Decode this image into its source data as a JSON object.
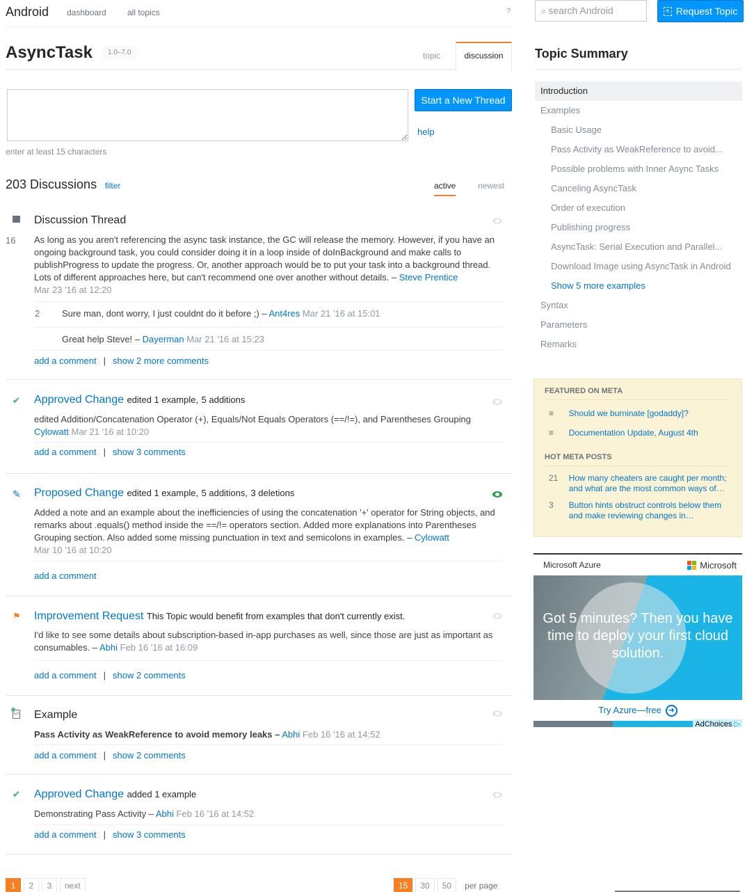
{
  "header": {
    "brand": "Android",
    "nav": [
      "dashboard",
      "all topics"
    ],
    "help_icon": "?",
    "search_placeholder": "search Android",
    "request_topic_label": "Request Topic"
  },
  "topic": {
    "title": "AsyncTask",
    "version": "1.0–7.0",
    "tabs": [
      {
        "label": "topic",
        "active": false
      },
      {
        "label": "discussion",
        "active": true
      }
    ]
  },
  "new_thread": {
    "input_value": "",
    "start_label": "Start a New Thread",
    "help_label": "help",
    "hint": "enter at least 15 characters"
  },
  "discussions": {
    "count_label": "203 Discussions",
    "filter_label": "filter",
    "sort": [
      {
        "label": "active",
        "active": true
      },
      {
        "label": "newest",
        "active": false
      }
    ]
  },
  "posts": [
    {
      "type": "Discussion Thread",
      "icon": "comment-bubble-icon",
      "votes": "16",
      "body": "As long as you aren't referencing the async task instance, the GC will release the memory. However, if you have an ongoing background task, you could consider doing it in a loop inside of doInBackground and make calls to publishProgress to update the progress. Or, another approach would be to put your task into a background thread. Lots of different approaches here, but can't recommend one over another without details. –",
      "author": "Steve Prentice",
      "time": "Mar 23 '16 at 12:20",
      "comments": [
        {
          "votes": "2",
          "text": "Sure man, dont worry, I just couldnt do it before ;) –",
          "author": "Ant4res",
          "time": "Mar 21 '16 at 15:01"
        },
        {
          "votes": "",
          "text": "Great help Steve! –",
          "author": "Dayerman",
          "time": "Mar 21 '16 at 15:23"
        }
      ],
      "add_comment": "add a comment",
      "show_comments": "show 2 more comments"
    },
    {
      "type": "Approved Change",
      "icon": "checkmark-icon",
      "meta": "edited 1 example,",
      "additions": "5 additions",
      "body": "edited Addition/Concatenation Operator (+), Equals/Not Equals Operators (==/!=), and Parentheses Grouping",
      "author": "Cylowatt",
      "time": "Mar 21 '16 at 10:20",
      "add_comment": "add a comment",
      "show_comments": "show 3 comments"
    },
    {
      "type": "Proposed Change",
      "icon": "pencil-icon",
      "meta": "edited 1 example,",
      "additions": "5 additions,",
      "deletions": "3 deletions",
      "body": "Added a note and an example about the inefficiencies of using the concatenation '+' operator for String objects, and remarks about .equals() method inside the ==/!= operators section. Added more explanations into Parentheses Grouping section. Also added some missing punctuation in text and semicolons in examples. –",
      "author": "Cylowatt",
      "time": "Mar 10 '16 at 10:20",
      "add_comment": "add a comment"
    },
    {
      "type": "Improvement Request",
      "icon": "flag-icon",
      "meta": "This Topic would benefit from examples that don't currently exist.",
      "body": "I'd like to see some details about subscription-based in-app purchases as well, since those are just as important as consumables. –",
      "author": "Abhi",
      "time": "Feb 16 '16 at 16:09",
      "add_comment": "add a comment",
      "show_comments": "show 2 comments"
    },
    {
      "type": "Example",
      "icon": "add-example-icon",
      "body": "Pass Activity as WeakReference to avoid memory leaks –",
      "author": "Abhi",
      "time": "Feb 16 '16 at 14:52",
      "add_comment": "add a comment",
      "show_comments": "show 2 comments"
    },
    {
      "type": "Approved Change",
      "icon": "checkmark-icon",
      "meta": "added 1 example",
      "body": "Demonstrating Pass Activity –",
      "author": "Abhi",
      "time": "Feb 16 '16 at 14:52",
      "add_comment": "add a comment",
      "show_comments": "show 3 comments"
    }
  ],
  "pagination": {
    "pages": [
      "1",
      "2",
      "3",
      "next"
    ],
    "current": "1",
    "per_page": [
      "15",
      "30",
      "50"
    ],
    "per_page_current": "15",
    "per_page_label": "per page"
  },
  "sidebar": {
    "title": "Topic Summary",
    "toc": [
      {
        "label": "Introduction",
        "level": 0,
        "active": true
      },
      {
        "label": "Examples",
        "level": 0
      },
      {
        "label": "Basic Usage",
        "level": 1
      },
      {
        "label": "Pass Activity as WeakReference to avoid...",
        "level": 1
      },
      {
        "label": "Possible problems with Inner Async Tasks",
        "level": 1
      },
      {
        "label": "Canceling AsyncTask",
        "level": 1
      },
      {
        "label": "Order of execution",
        "level": 1
      },
      {
        "label": "Publishing progress",
        "level": 1
      },
      {
        "label": "AsyncTask: Serial Execution and Parallel...",
        "level": 1
      },
      {
        "label": "Download Image using AsyncTask in Android",
        "level": 1
      },
      {
        "label": "Show 5 more examples",
        "level": 1,
        "link": true
      },
      {
        "label": "Syntax",
        "level": 0
      },
      {
        "label": "Parameters",
        "level": 0
      },
      {
        "label": "Remarks",
        "level": 0
      }
    ],
    "featured_heading": "FEATURED ON META",
    "featured": [
      "Should we burninate [godaddy]?",
      "Documentation Update, August 4th"
    ],
    "hot_heading": "HOT META POSTS",
    "hot": [
      {
        "count": "21",
        "title": "How many cheaters are caught per month; and what are the most common ways of…"
      },
      {
        "count": "3",
        "title": "Button hints obstruct controls below them and make reviewing changes in…"
      }
    ],
    "ad": {
      "sponsor": "Microsoft Azure",
      "brand": "Microsoft",
      "headline": "Got 5 minutes? Then you have time to deploy your first cloud solution.",
      "cta": "Try Azure—free",
      "adchoices": "AdChoices"
    }
  },
  "colors": {
    "accent_blue": "#0095ff",
    "link_blue": "#0077cc",
    "orange": "#f48024",
    "approved_green": "#5eba7d",
    "additions_green": "#3d6b00",
    "deletions_red": "#c02d2e",
    "meta_bg": "#fbf3d5"
  }
}
